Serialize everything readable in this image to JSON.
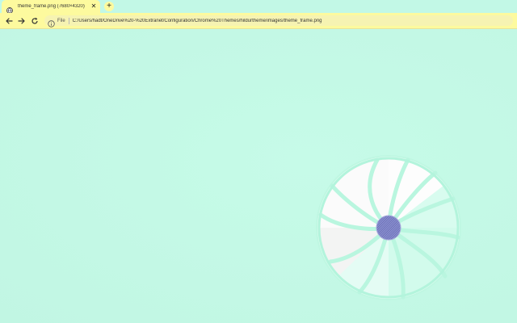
{
  "tab": {
    "title": "theme_frame.png (7680×4320)",
    "favicon": "globe-icon",
    "close_icon": "close-icon"
  },
  "newtab": {
    "icon": "plus-icon",
    "label": "+"
  },
  "toolbar": {
    "back_icon": "back-arrow-icon",
    "forward_icon": "forward-arrow-icon",
    "reload_icon": "reload-icon"
  },
  "omnibox": {
    "info_icon": "info-icon",
    "scheme": "File",
    "url": "C:/Users/hadt/OneDrive%20-%20Extranet/Configuration/Chrome%20Themes/hildurtheme/images/theme_frame.png"
  },
  "colors": {
    "frame": "#c2f8e6",
    "toolbar": "#fdfa9e",
    "page_background": "#c4f9e6",
    "emblem_center": "#8a8fd0"
  }
}
